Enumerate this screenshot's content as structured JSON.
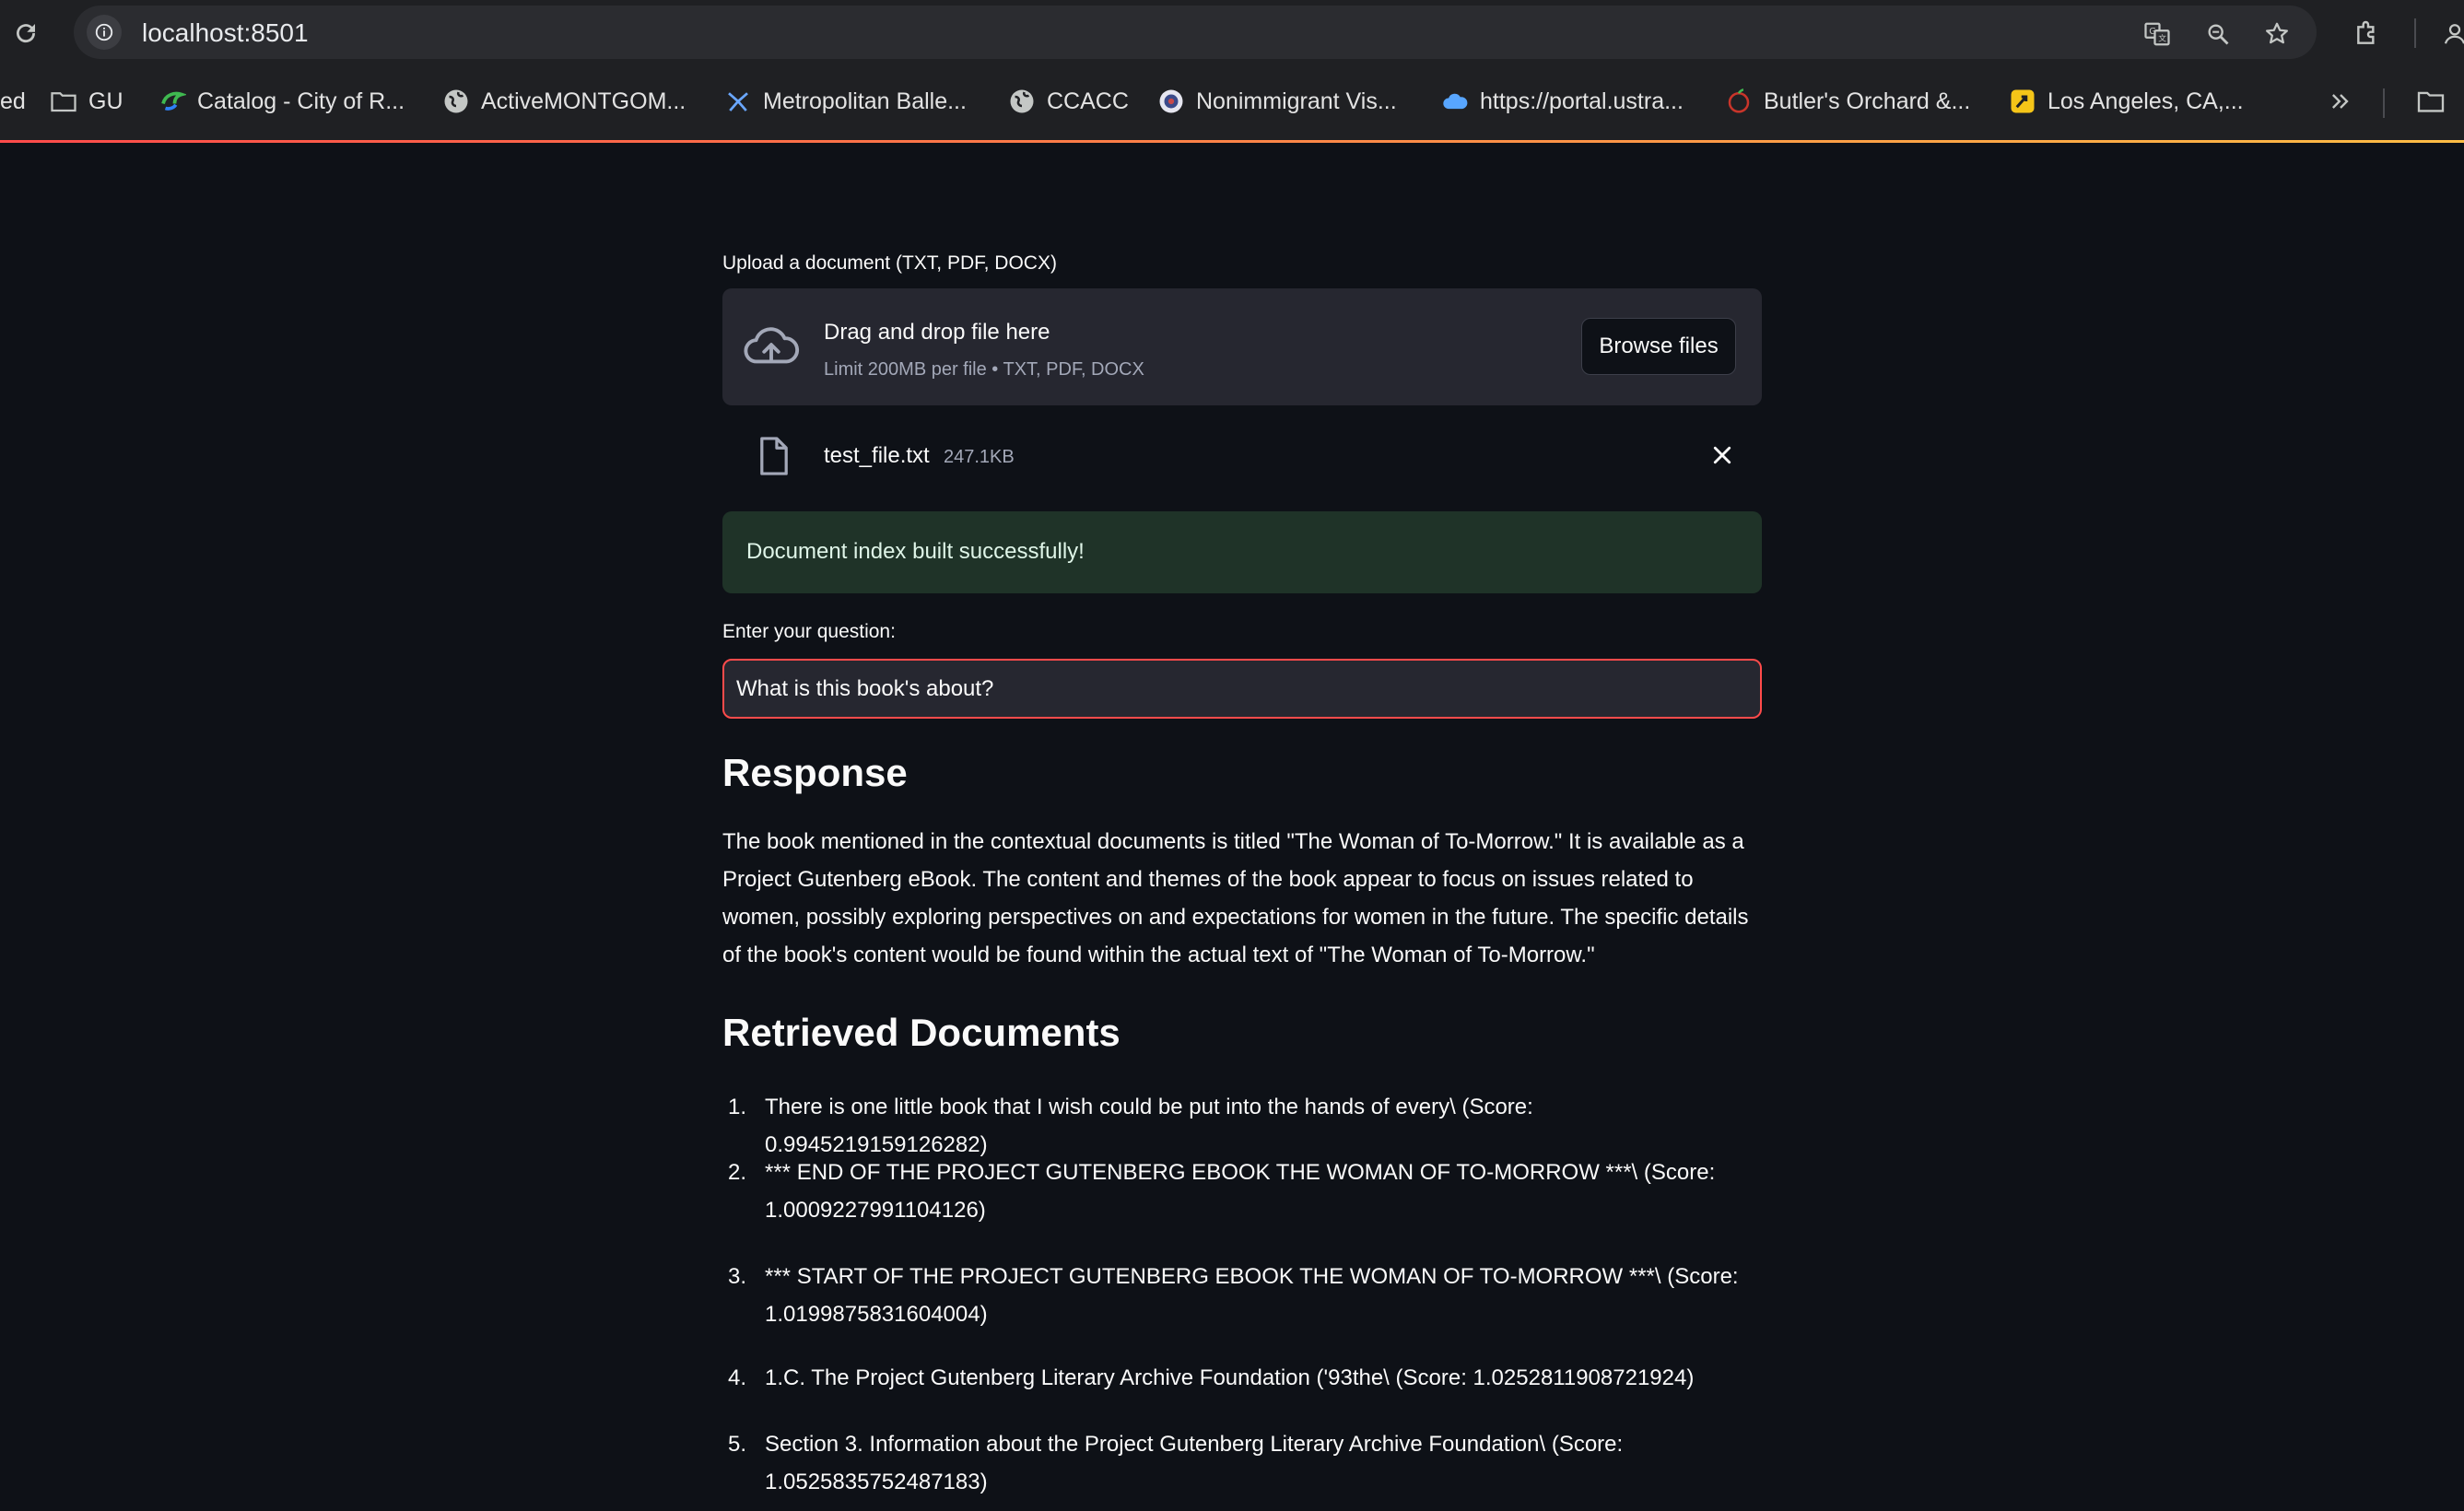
{
  "browser": {
    "url": "localhost:8501",
    "bookmarks": [
      {
        "label": "ed",
        "icon": "none"
      },
      {
        "label": "GU",
        "icon": "folder-icon"
      },
      {
        "label": "Catalog - City of R...",
        "icon": "catalog-icon"
      },
      {
        "label": "ActiveMONTGOM...",
        "icon": "globe-icon"
      },
      {
        "label": "Metropolitan Balle...",
        "icon": "ballet-icon"
      },
      {
        "label": "CCACC",
        "icon": "globe-icon"
      },
      {
        "label": "Nonimmigrant Vis...",
        "icon": "seal-icon"
      },
      {
        "label": "https://portal.ustra...",
        "icon": "cloud-icon"
      },
      {
        "label": "Butler's Orchard &...",
        "icon": "orchard-icon"
      },
      {
        "label": "Los Angeles, CA,...",
        "icon": "la-icon"
      }
    ]
  },
  "uploader": {
    "label": "Upload a document (TXT, PDF, DOCX)",
    "drop_title": "Drag and drop file here",
    "limit_text": "Limit 200MB per file • TXT, PDF, DOCX",
    "browse_label": "Browse files"
  },
  "file": {
    "name": "test_file.txt",
    "size": "247.1KB"
  },
  "success": {
    "message": "Document index built successfully!"
  },
  "question": {
    "label": "Enter your question:",
    "value": "What is this book's about?"
  },
  "response": {
    "heading": "Response",
    "text": "The book mentioned in the contextual documents is titled \"The Woman of To-Morrow.\" It is available as a Project Gutenberg eBook. The content and themes of the book appear to focus on issues related to women, possibly exploring perspectives on and expectations for women in the future. The specific details of the book's content would be found within the actual text of \"The Woman of To-Morrow.\""
  },
  "retrieved": {
    "heading": "Retrieved Documents",
    "items": [
      {
        "num": "1.",
        "text": "There is one little book that I wish could be put into the hands of every\\ (Score: 0.9945219159126282)"
      },
      {
        "num": "2.",
        "text": "*** END OF THE PROJECT GUTENBERG EBOOK THE WOMAN OF TO-MORROW ***\\ (Score: 1.0009227991104126)"
      },
      {
        "num": "3.",
        "text": "*** START OF THE PROJECT GUTENBERG EBOOK THE WOMAN OF TO-MORROW ***\\ (Score: 1.0199875831604004)"
      },
      {
        "num": "4.",
        "text": "1.C. The Project Gutenberg Literary Archive Foundation ('93the\\ (Score: 1.0252811908721924)"
      },
      {
        "num": "5.",
        "text": "Section 3. Information about the Project Gutenberg Literary Archive Foundation\\ (Score: 1.0525835752487183)"
      }
    ]
  },
  "colors": {
    "background": "#0e1117",
    "secondary_bg": "#262730",
    "primary": "#ff4b4b",
    "success_bg": "#1f3328"
  }
}
